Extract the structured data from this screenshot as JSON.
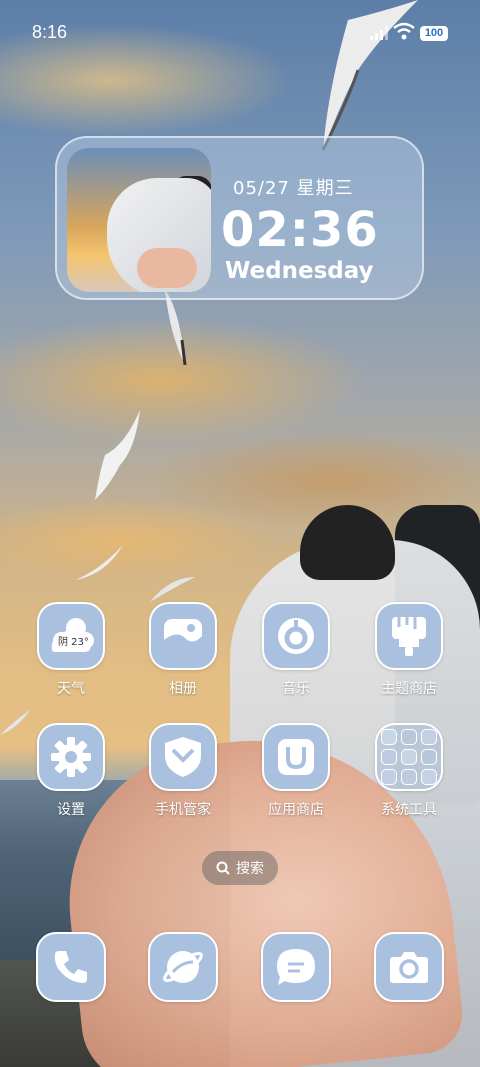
{
  "status_bar": {
    "time": "8:16",
    "battery": "100"
  },
  "widget": {
    "date": "05/27 星期三",
    "clock": "02:36",
    "day": "Wednesday"
  },
  "apps": [
    {
      "label": "天气",
      "icon": "weather-icon",
      "badge": "阴 23°"
    },
    {
      "label": "相册",
      "icon": "gallery-icon"
    },
    {
      "label": "音乐",
      "icon": "music-icon"
    },
    {
      "label": "主题商店",
      "icon": "theme-store-icon"
    },
    {
      "label": "设置",
      "icon": "gear-icon"
    },
    {
      "label": "手机管家",
      "icon": "shield-icon"
    },
    {
      "label": "应用商店",
      "icon": "shopping-bag-icon"
    },
    {
      "label": "系统工具",
      "icon": "folder-icon"
    }
  ],
  "search": {
    "label": "搜索"
  },
  "dock": [
    {
      "icon": "phone-icon"
    },
    {
      "icon": "browser-icon"
    },
    {
      "icon": "message-icon"
    },
    {
      "icon": "camera-icon"
    }
  ],
  "colors": {
    "icon_bg": "#a9c1df",
    "icon_glyph": "#ffffff",
    "battery_text": "#2f6ccc"
  }
}
